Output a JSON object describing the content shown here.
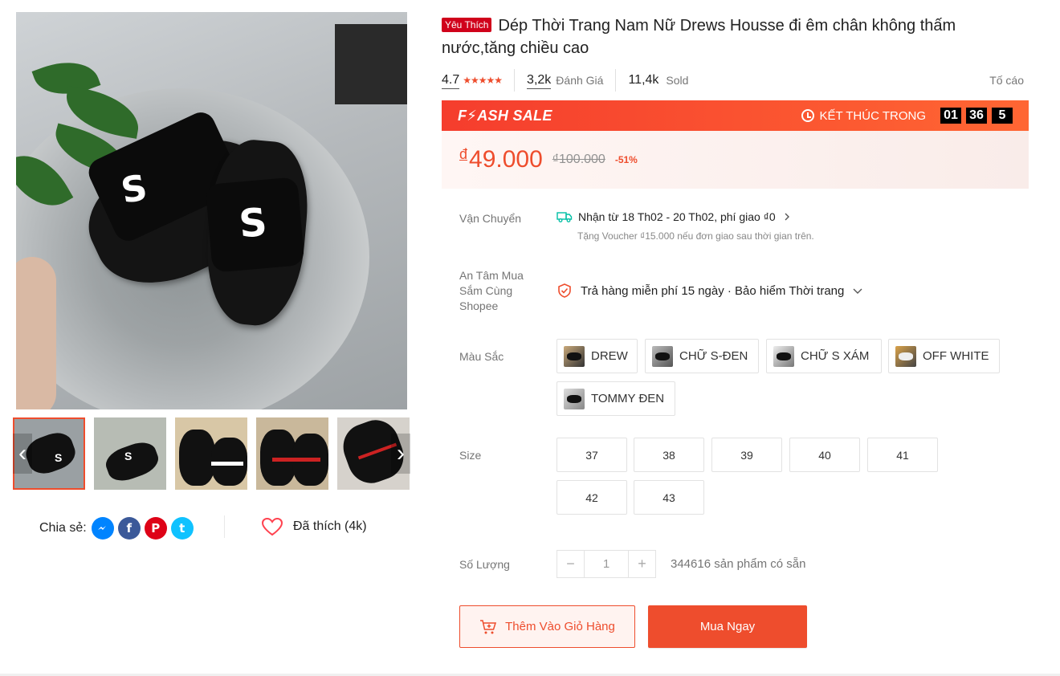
{
  "gallery": {
    "main_letters": [
      "S",
      "S"
    ],
    "thumb_letter": "S",
    "prev_arrow": "‹",
    "next_arrow": "›"
  },
  "share": {
    "label": "Chia sẻ:",
    "icons": [
      "messenger-icon",
      "facebook-icon",
      "pinterest-icon",
      "twitter-icon"
    ],
    "facebook_glyph": "f",
    "pinterest_glyph": "P",
    "twitter_glyph": "t"
  },
  "like": {
    "label": "Đã thích (4k)"
  },
  "product": {
    "badge": "Yêu Thích",
    "title": "Dép Thời Trang Nam Nữ Drews Housse đi êm chân không thấm nước,tăng chiều cao"
  },
  "stats": {
    "rating": "4.7",
    "stars": "★★★★★",
    "reviews_count": "3,2k",
    "reviews_label": "Đánh Giá",
    "sold_count": "11,4k",
    "sold_label": "Sold",
    "report": "Tố cáo"
  },
  "flash_sale": {
    "title": "F⚡ASH SALE",
    "ends_label": "KẾT THÚC TRONG",
    "hours": "01",
    "minutes": "36",
    "seconds": "5"
  },
  "price": {
    "currency": "đ",
    "current": "49.000",
    "original": "₫100.000",
    "discount": "-51%"
  },
  "shipping": {
    "label": "Vận Chuyển",
    "line": "Nhận từ 18 Th02 - 20 Th02, phí giao ₫0",
    "sub": "Tặng Voucher ₫15.000 nếu đơn giao sau thời gian trên."
  },
  "guarantee": {
    "label": "An Tâm Mua Sắm Cùng Shopee",
    "text": "Trả hàng miễn phí 15 ngày · Bảo hiểm Thời trang"
  },
  "colors": {
    "label": "Màu Sắc",
    "options": [
      "DREW",
      "CHỮ S-ĐEN",
      "CHỮ S XÁM",
      "OFF WHITE",
      "TOMMY ĐEN"
    ]
  },
  "sizes": {
    "label": "Size",
    "options": [
      "37",
      "38",
      "39",
      "40",
      "41",
      "42",
      "43"
    ]
  },
  "quantity": {
    "label": "Số Lượng",
    "minus": "−",
    "value": "1",
    "plus": "+",
    "stock": "344616 sản phẩm có sẵn"
  },
  "actions": {
    "add_to_cart": "Thêm Vào Giỏ Hàng",
    "buy_now": "Mua Ngay"
  },
  "theme": {
    "accent": "#ee4d2d",
    "badge": "#d0011b"
  }
}
